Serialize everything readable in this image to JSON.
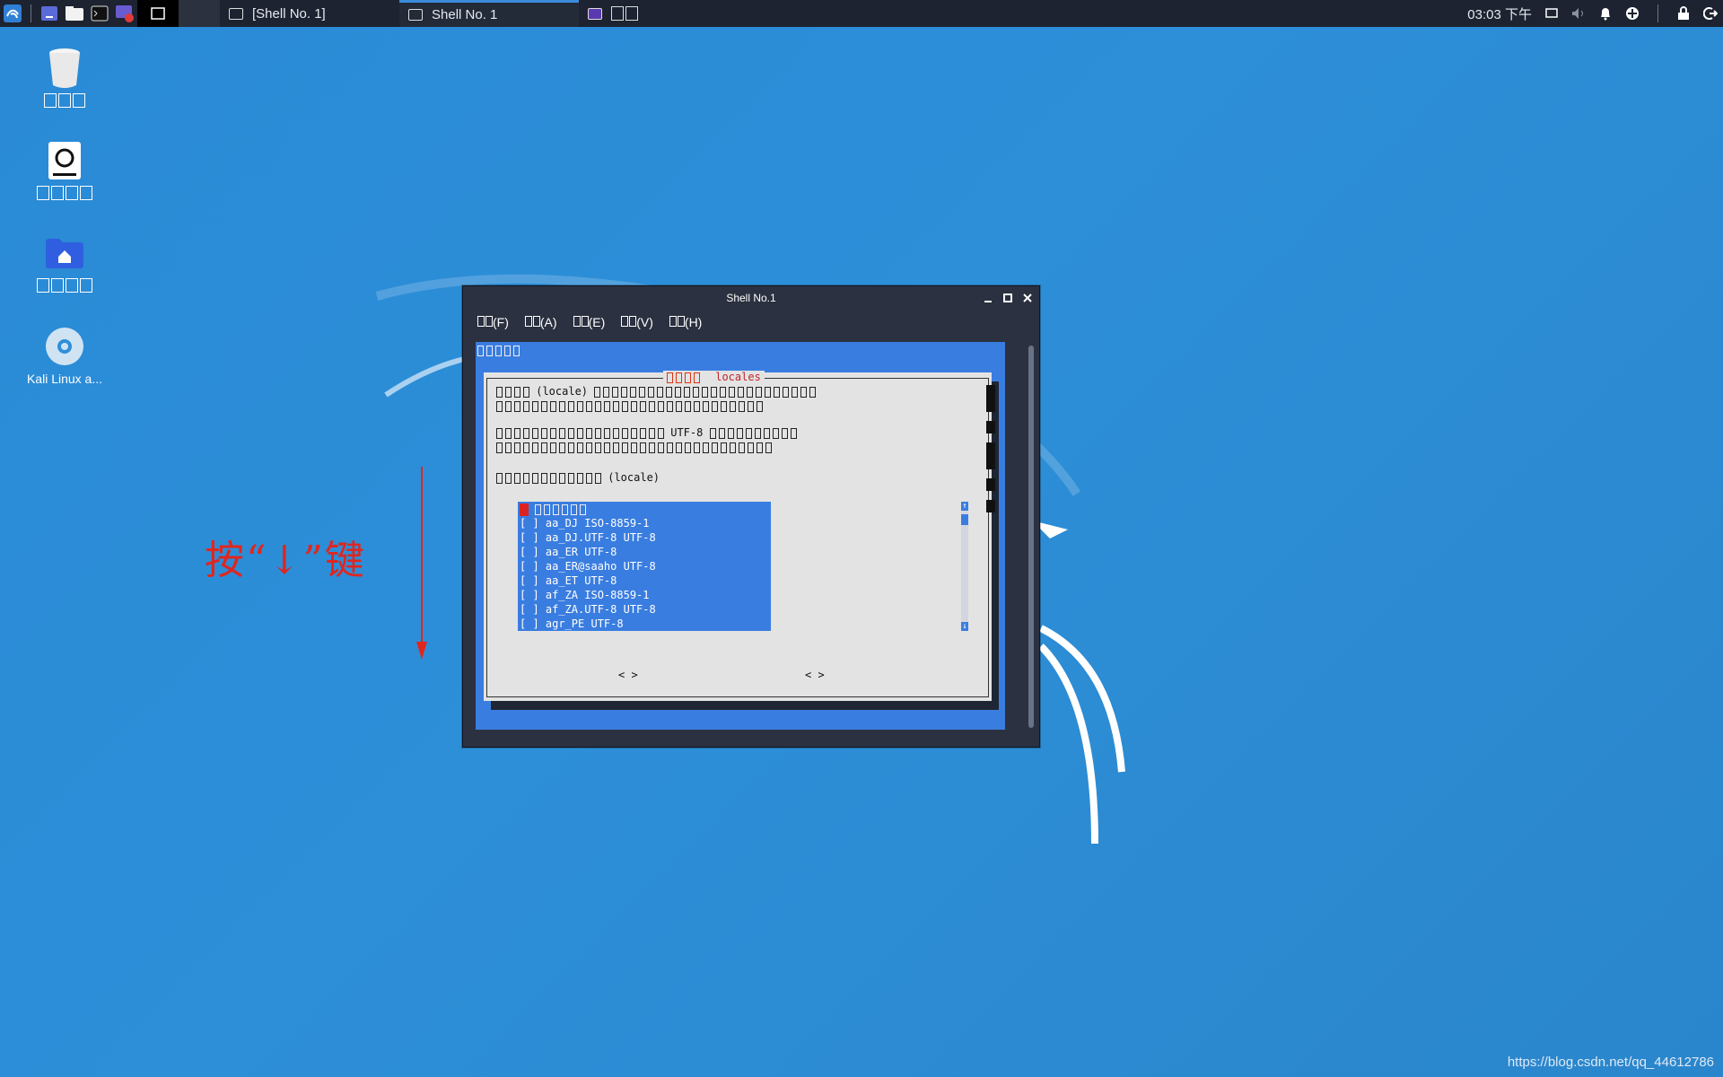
{
  "colors": {
    "desktop_bg": "#2d8fd8",
    "taskbar": "#1d2330",
    "terminal_blue": "#3a7de0",
    "dialog_bg": "#e3e3e3",
    "annotation_red": "#e0261f"
  },
  "taskbar": {
    "tasks": [
      {
        "label": "[Shell No. 1]",
        "icon": "terminal-icon"
      },
      {
        "label": "Shell No. 1",
        "icon": "terminal-icon"
      }
    ],
    "clock": "03:03 下午"
  },
  "desktop": {
    "icons": [
      {
        "name": "trash-icon"
      },
      {
        "name": "filesystem-icon"
      },
      {
        "name": "home-folder-icon"
      },
      {
        "name": "disc-icon",
        "label": "Kali Linux a..."
      }
    ]
  },
  "annotation": {
    "text": "按“↓”键"
  },
  "window": {
    "title": "Shell No.1",
    "menu": [
      "(F)",
      "(A)",
      "(E)",
      "(V)",
      "(H)"
    ],
    "dialog": {
      "title_word": "locales",
      "line1_word": "(locale)",
      "line3_word": "UTF-8",
      "line5_word": "(locale)",
      "list_items": [
        "[ ] aa_DJ ISO-8859-1",
        "[ ] aa_DJ.UTF-8 UTF-8",
        "[ ] aa_ER UTF-8",
        "[ ] aa_ER@saaho UTF-8",
        "[ ] aa_ET UTF-8",
        "[ ] af_ZA ISO-8859-1",
        "[ ] af_ZA.UTF-8 UTF-8",
        "[ ] agr_PE UTF-8"
      ],
      "ok_button": "< >",
      "cancel_button": "< >"
    }
  },
  "watermark": "https://blog.csdn.net/qq_44612786"
}
